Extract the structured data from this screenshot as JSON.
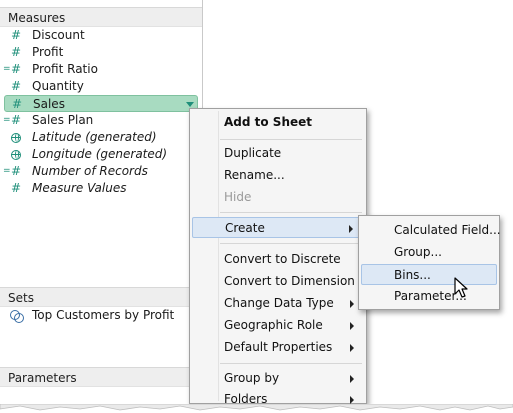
{
  "pane": {
    "measures_header": "Measures",
    "measures": [
      {
        "label": "Discount",
        "icon": "hash-icon",
        "italic": false,
        "calc": false
      },
      {
        "label": "Profit",
        "icon": "hash-icon",
        "italic": false,
        "calc": false
      },
      {
        "label": "Profit Ratio",
        "icon": "calc-hash-icon",
        "italic": false,
        "calc": true
      },
      {
        "label": "Quantity",
        "icon": "hash-icon",
        "italic": false,
        "calc": false
      },
      {
        "label": "Sales",
        "icon": "hash-icon",
        "italic": false,
        "calc": false,
        "selected": true
      },
      {
        "label": "Sales Plan",
        "icon": "calc-hash-icon",
        "italic": false,
        "calc": true
      },
      {
        "label": "Latitude (generated)",
        "icon": "globe-icon",
        "italic": true,
        "calc": false
      },
      {
        "label": "Longitude (generated)",
        "icon": "globe-icon",
        "italic": true,
        "calc": false
      },
      {
        "label": "Number of Records",
        "icon": "calc-hash-icon",
        "italic": true,
        "calc": true
      },
      {
        "label": "Measure Values",
        "icon": "hash-icon",
        "italic": true,
        "calc": false
      }
    ],
    "sets_header": "Sets",
    "sets": [
      {
        "label": "Top Customers by Profit",
        "icon": "set-icon"
      }
    ],
    "parameters_header": "Parameters"
  },
  "context_menu": {
    "items": {
      "add_to_sheet": "Add to Sheet",
      "duplicate": "Duplicate",
      "rename": "Rename...",
      "hide": "Hide",
      "create": "Create",
      "convert_discrete": "Convert to Discrete",
      "convert_dimension": "Convert to Dimension",
      "change_data_type": "Change Data Type",
      "geographic_role": "Geographic Role",
      "default_properties": "Default Properties",
      "group_by": "Group by",
      "folders": "Folders"
    }
  },
  "submenu": {
    "calculated_field": "Calculated Field...",
    "group": "Group...",
    "bins": "Bins...",
    "parameter": "Parameter..."
  },
  "colors": {
    "measure_icon": "#1f8f7a",
    "selected_bg": "#a8dbc1",
    "highlight_bg": "#dde8f5"
  }
}
